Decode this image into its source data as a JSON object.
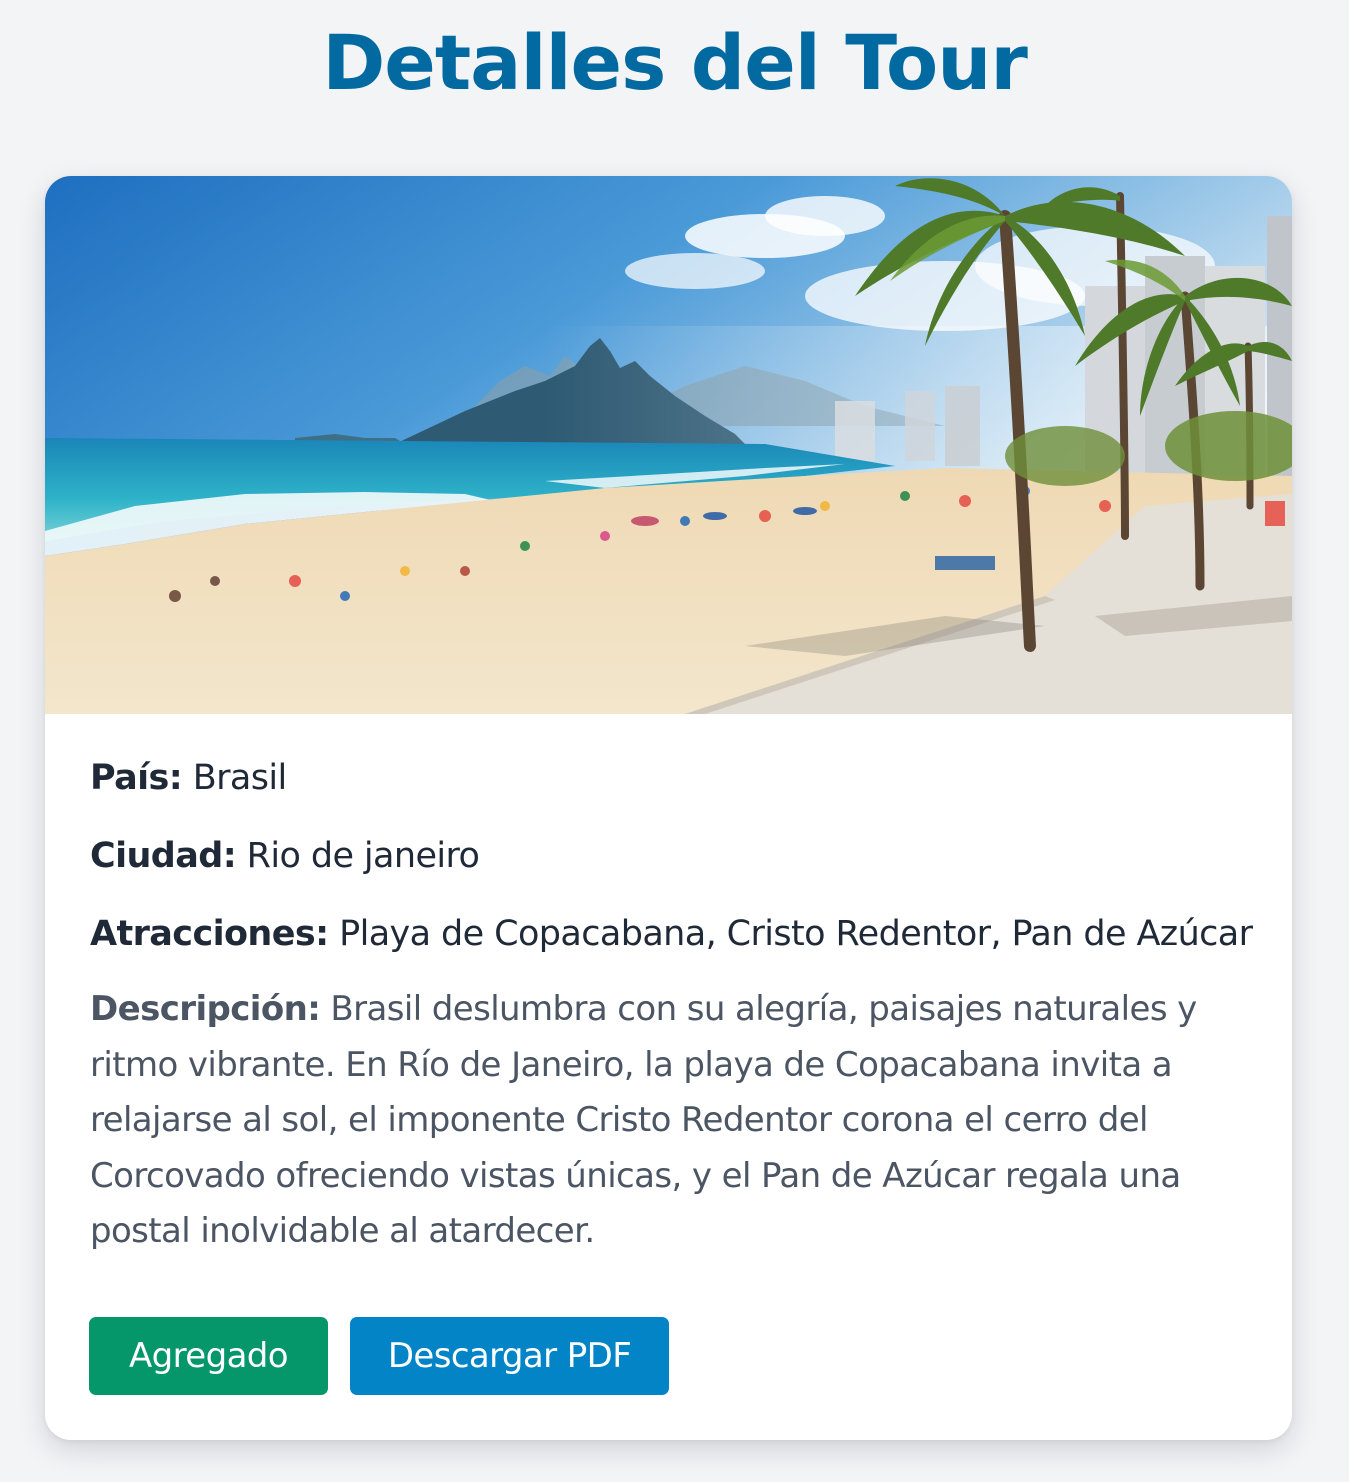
{
  "page": {
    "title": "Detalles del Tour"
  },
  "tour": {
    "image_alt": "Playa de Ipanema, Rio de janeiro",
    "country_label": "País:",
    "country": "Brasil",
    "city_label": "Ciudad:",
    "city": "Rio de janeiro",
    "attractions_label": "Atracciones:",
    "attractions": "Playa de Copacabana, Cristo Redentor, Pan de Azúcar",
    "description_label": "Descripción:",
    "description": "Brasil deslumbra con su alegría, paisajes naturales y ritmo vibrante. En Río de Janeiro, la playa de Copacabana invita a relajarse al sol, el imponente Cristo Redentor corona el cerro del Corcovado ofreciendo vistas únicas, y el Pan de Azúcar regala una postal inolvidable al atardecer."
  },
  "actions": {
    "added_label": "Agregado",
    "added_color": "#059669",
    "pdf_label": "Descargar PDF",
    "pdf_color": "#0284c7"
  },
  "theme": {
    "title_color": "#0369a1",
    "background": "#f3f4f6"
  }
}
